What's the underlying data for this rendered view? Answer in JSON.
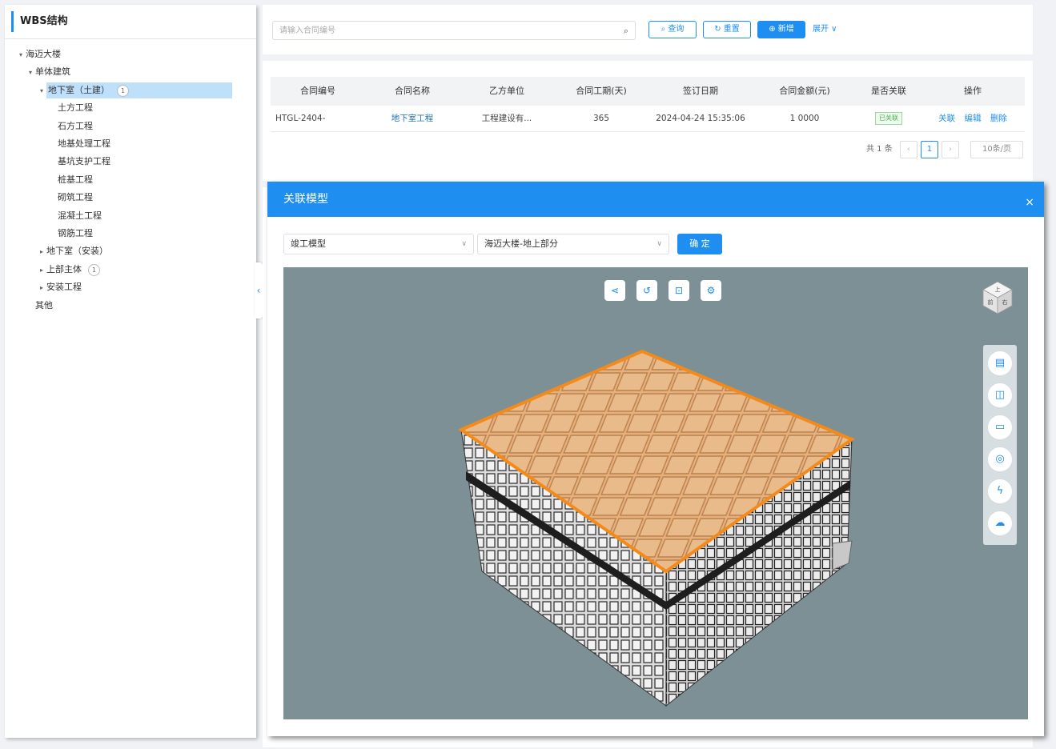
{
  "wbs": {
    "title": "WBS结构",
    "tree": [
      {
        "label": "海迈大楼",
        "arrow": "▾",
        "level": 0
      },
      {
        "label": "单体建筑",
        "arrow": "▾",
        "level": 1
      },
      {
        "label": "地下室（土建）",
        "arrow": "▾",
        "level": 2,
        "badge": "1",
        "selected": true
      },
      {
        "label": "土方工程",
        "arrow": "",
        "level": 3
      },
      {
        "label": "石方工程",
        "arrow": "",
        "level": 3
      },
      {
        "label": "地基处理工程",
        "arrow": "",
        "level": 3
      },
      {
        "label": "基坑支护工程",
        "arrow": "",
        "level": 3
      },
      {
        "label": "桩基工程",
        "arrow": "",
        "level": 3
      },
      {
        "label": "砌筑工程",
        "arrow": "",
        "level": 3
      },
      {
        "label": "混凝土工程",
        "arrow": "",
        "level": 3
      },
      {
        "label": "钢筋工程",
        "arrow": "",
        "level": 3
      },
      {
        "label": "地下室（安装）",
        "arrow": "▸",
        "level": 2
      },
      {
        "label": "上部主体",
        "arrow": "▸",
        "level": 2,
        "badge": "1"
      },
      {
        "label": "安装工程",
        "arrow": "▸",
        "level": 2
      },
      {
        "label": "其他",
        "arrow": "",
        "level": 1
      }
    ],
    "collapse_icon": "‹"
  },
  "search": {
    "placeholder": "请输入合同编号",
    "query_label": "查询",
    "reset_label": "重置",
    "add_label": "新增",
    "expand_label": "展开 ∨"
  },
  "table": {
    "headers": [
      "合同编号",
      "合同名称",
      "乙方单位",
      "合同工期(天)",
      "签订日期",
      "合同金额(元)",
      "是否关联",
      "操作"
    ],
    "row": {
      "code": "HTGL-2404-",
      "name": "地下室工程",
      "party_b": "工程建设有...",
      "duration": "365",
      "date": "2024-04-24 15:35:06",
      "amount": "1 0000",
      "linked": "已关联",
      "ops": [
        "关联",
        "编辑",
        "删除"
      ]
    },
    "pagination": {
      "total": "共 1 条",
      "prev": "‹",
      "page": "1",
      "next": "›",
      "page_size": "10条/页"
    }
  },
  "modal": {
    "title": "关联模型",
    "close": "×",
    "select_type": "竣工模型",
    "select_model": "海迈大楼-地上部分",
    "confirm_label": "确 定",
    "top_tools": [
      "share-icon",
      "reset-view-icon",
      "section-icon",
      "settings-icon"
    ],
    "side_tools": [
      "document-icon",
      "box-select-icon",
      "measure-icon",
      "target-icon",
      "lightning-icon",
      "cloud-icon"
    ],
    "cube_labels": [
      "上",
      "前",
      "右"
    ]
  },
  "colors": {
    "accent": "#1e8ef0",
    "viewer_bg": "#7c9096",
    "roof": "#e8b07a",
    "roof_edge": "#f28a1c"
  }
}
